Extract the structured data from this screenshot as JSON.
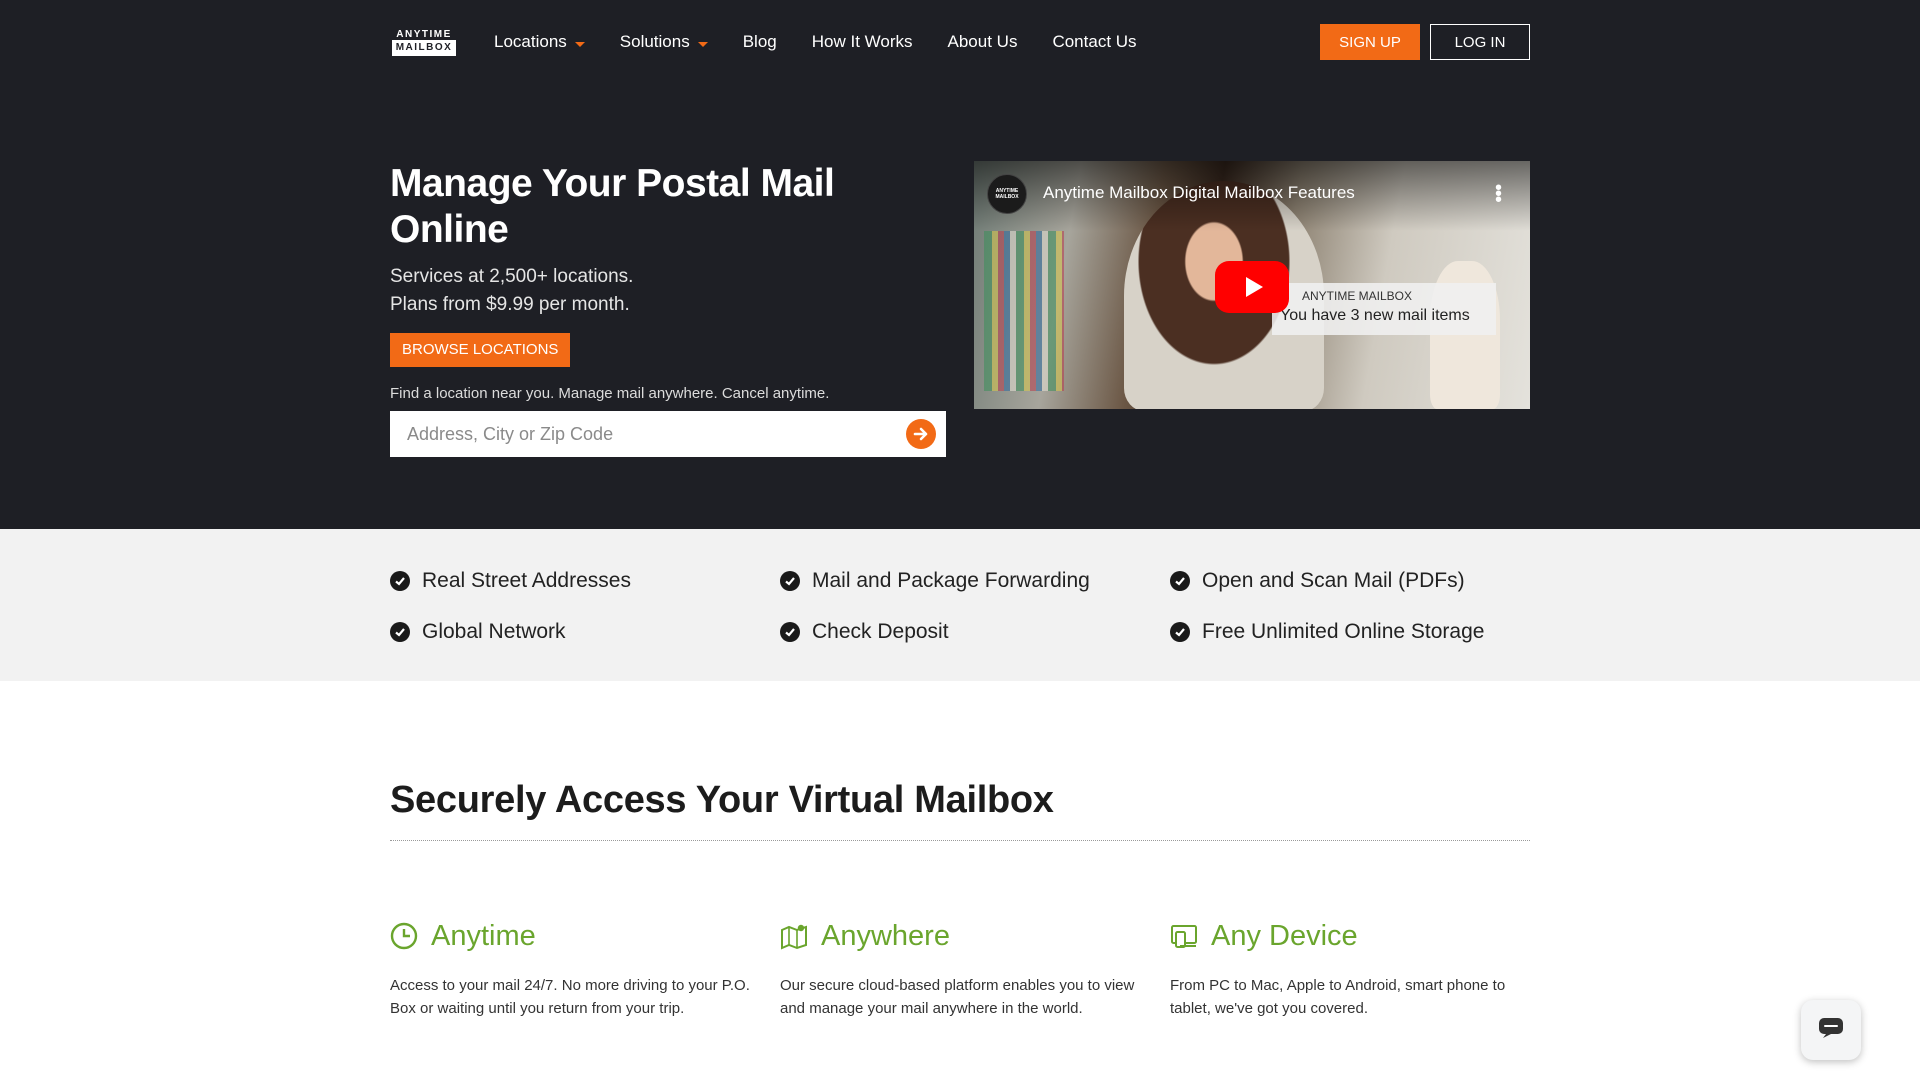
{
  "logo": {
    "line1": "ANYTIME",
    "line2": "MAILBOX"
  },
  "nav": {
    "items": [
      {
        "label": "Locations",
        "dropdown": true
      },
      {
        "label": "Solutions",
        "dropdown": true
      },
      {
        "label": "Blog",
        "dropdown": false
      },
      {
        "label": "How It Works",
        "dropdown": false
      },
      {
        "label": "About Us",
        "dropdown": false
      },
      {
        "label": "Contact Us",
        "dropdown": false
      }
    ],
    "signup": "SIGN UP",
    "login": "LOG IN"
  },
  "hero": {
    "title": "Manage Your Postal Mail Online",
    "sub1": "Services at 2,500+ locations.",
    "sub2": "Plans from $9.99 per month.",
    "browse": "BROWSE LOCATIONS",
    "find": "Find a location near you. Manage mail anywhere. Cancel anytime.",
    "search_placeholder": "Address, City or Zip Code"
  },
  "video": {
    "channel_line1": "ANYTIME",
    "channel_line2": "MAILBOX",
    "title": "Anytime Mailbox Digital Mailbox Features",
    "notif_brand": "ANYTIME MAILBOX",
    "notif_text": "You have 3 new mail items"
  },
  "features": [
    "Real Street Addresses",
    "Mail and Package Forwarding",
    "Open and Scan Mail (PDFs)",
    "Global Network",
    "Check Deposit",
    "Free Unlimited Online Storage"
  ],
  "secure": {
    "title": "Securely Access Your Virtual Mailbox",
    "cols": [
      {
        "icon": "clock-icon",
        "title": "Anytime",
        "text": "Access to your mail 24/7. No more driving to your P.O. Box or waiting until you return from your trip."
      },
      {
        "icon": "map-icon",
        "title": "Anywhere",
        "text": "Our secure cloud-based platform enables you to view and manage your mail anywhere in the world."
      },
      {
        "icon": "devices-icon",
        "title": "Any Device",
        "text": "From PC to Mac, Apple to Android, smart phone to tablet, we've got you covered."
      }
    ]
  },
  "colors": {
    "accent": "#f26a16",
    "dark": "#1e1f25",
    "green": "#6aa52d",
    "strip": "#f2f2f2"
  }
}
